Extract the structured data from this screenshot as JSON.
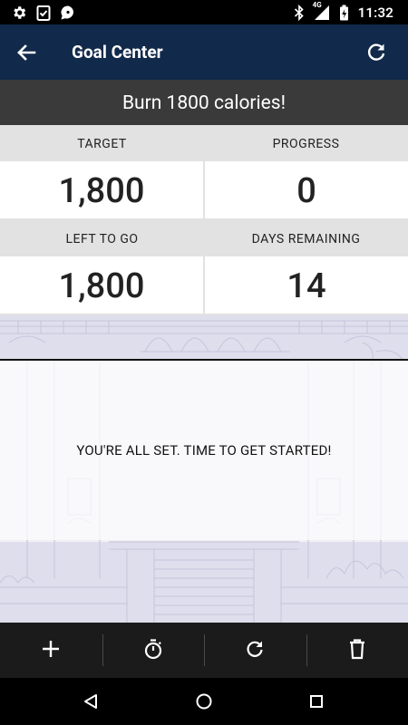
{
  "status_bar": {
    "time": "11:32",
    "network": "4G",
    "left_icons": [
      "settings-icon",
      "clipboard-check-icon",
      "chat-bubble-icon"
    ],
    "right_icons": [
      "bluetooth-icon",
      "signal-4g-icon",
      "battery-icon"
    ]
  },
  "app_bar": {
    "title": "Goal Center",
    "back_icon": "arrow-back-icon",
    "refresh_icon": "refresh-icon",
    "background": "#11294a"
  },
  "goal": {
    "title": "Burn 1800 calories!"
  },
  "stats": {
    "target_label": "TARGET",
    "target_value": "1,800",
    "progress_label": "PROGRESS",
    "progress_value": "0",
    "left_label": "LEFT TO GO",
    "left_value": "1,800",
    "days_label": "DAYS REMAINING",
    "days_value": "14"
  },
  "main": {
    "message": "YOU'RE ALL SET. TIME TO GET STARTED!"
  },
  "toolbar": {
    "items": [
      {
        "icon": "add-icon"
      },
      {
        "icon": "stopwatch-icon"
      },
      {
        "icon": "refresh-icon"
      },
      {
        "icon": "trash-icon"
      }
    ]
  },
  "nav_bar": {
    "buttons": [
      "back-triangle-icon",
      "home-circle-icon",
      "recents-square-icon"
    ]
  }
}
